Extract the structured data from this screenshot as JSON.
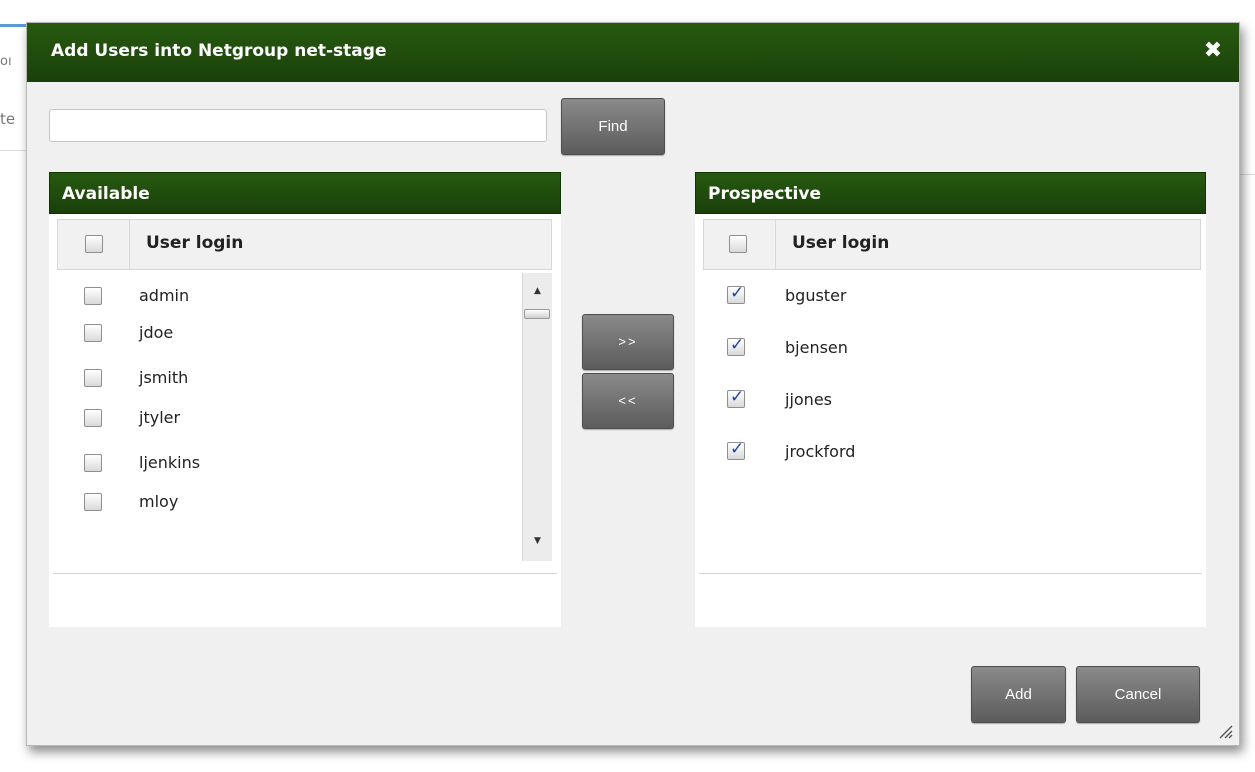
{
  "background": {
    "fragment_top": "oı",
    "fragment_mid": "te"
  },
  "dialog": {
    "title": "Add Users into Netgroup net-stage",
    "close_glyph": "✖"
  },
  "search": {
    "value": "",
    "placeholder": "",
    "find_label": "Find"
  },
  "available": {
    "header": "Available",
    "column": "User login",
    "select_all_checked": false,
    "rows": [
      {
        "login": "admin",
        "checked": false
      },
      {
        "login": "jdoe",
        "checked": false
      },
      {
        "login": "jsmith",
        "checked": false
      },
      {
        "login": "jtyler",
        "checked": false
      },
      {
        "login": "ljenkins",
        "checked": false
      },
      {
        "login": "mloy",
        "checked": false
      }
    ],
    "scroll_up_glyph": "▲",
    "scroll_down_glyph": "▼"
  },
  "transfer": {
    "move_right_label": ">>",
    "move_left_label": "<<"
  },
  "prospective": {
    "header": "Prospective",
    "column": "User login",
    "select_all_checked": false,
    "rows": [
      {
        "login": "bguster",
        "checked": true
      },
      {
        "login": "bjensen",
        "checked": true
      },
      {
        "login": "jjones",
        "checked": true
      },
      {
        "login": "jrockford",
        "checked": true
      }
    ]
  },
  "footer": {
    "add_label": "Add",
    "cancel_label": "Cancel"
  }
}
